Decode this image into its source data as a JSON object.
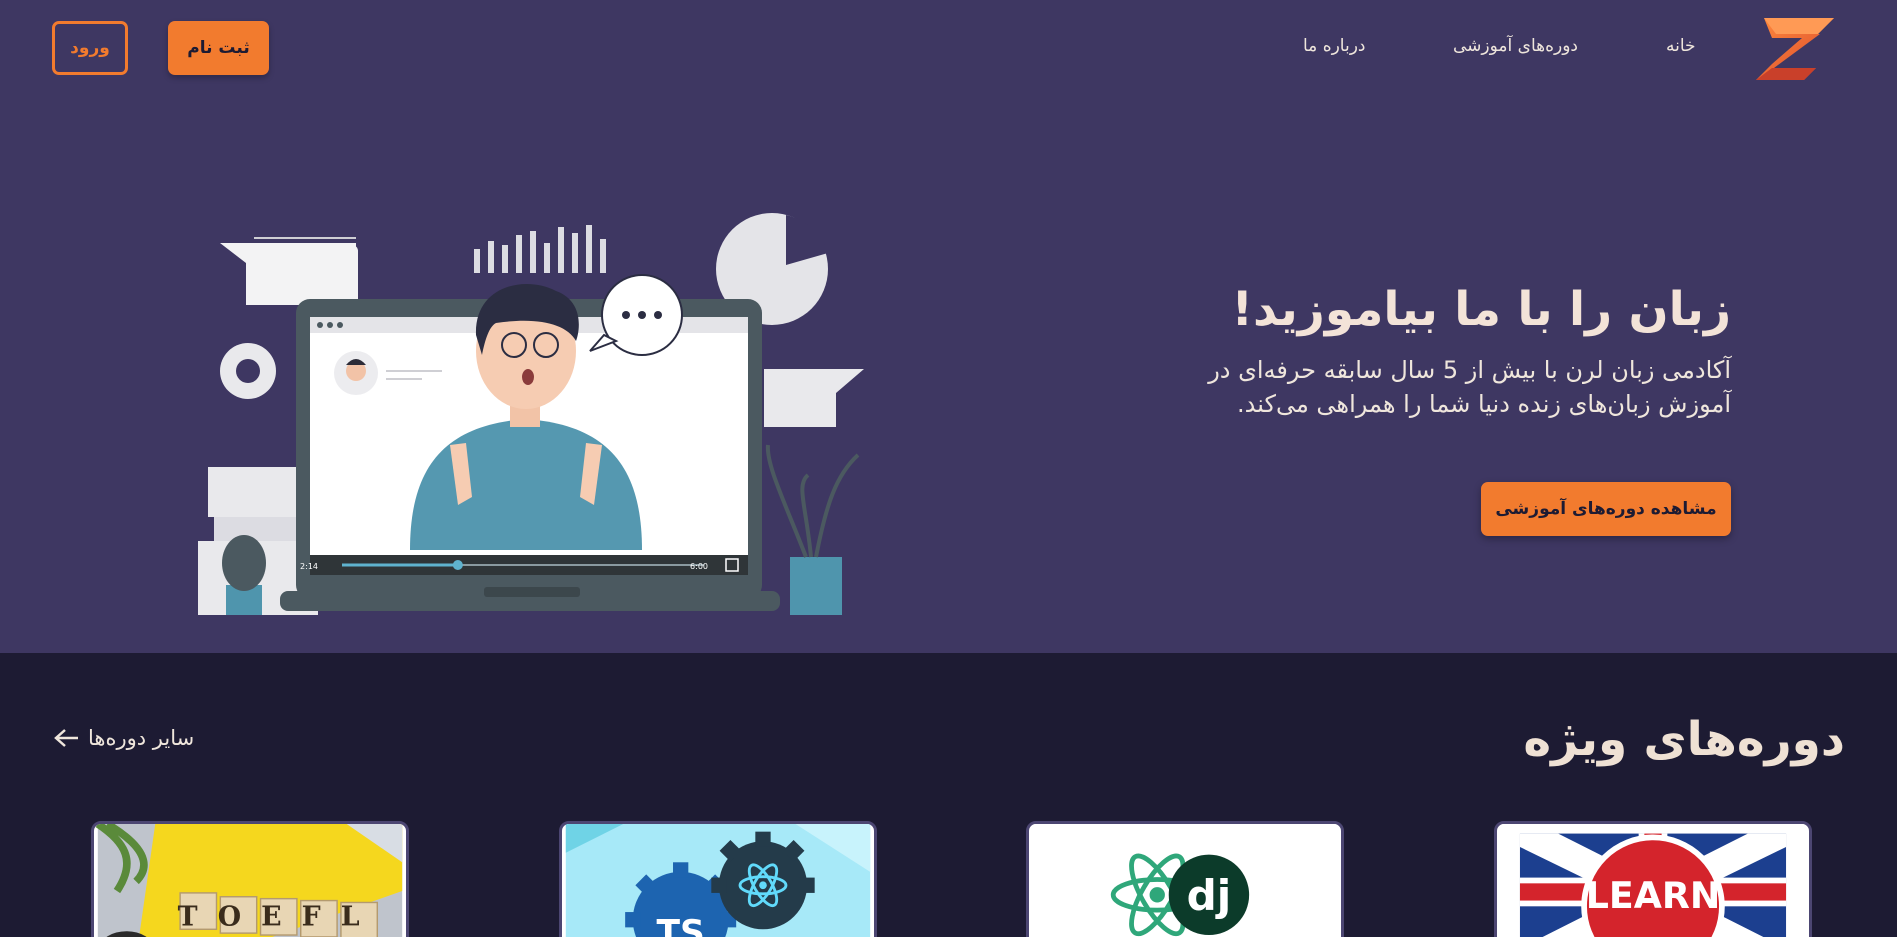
{
  "header": {
    "logo_icon": "z-logo-icon",
    "nav": {
      "home": "خانه",
      "courses": "دوره‌های آموزشی",
      "about": "درباره ما"
    },
    "signup_label": "ثبت نام",
    "login_label": "ورود"
  },
  "hero": {
    "title": "زبان را با ما بیاموزید!",
    "description": "آکادمی زبان لرن با بیش از 5 سال سابقه حرفه‌ای در آموزش زبان‌های زنده دنیا شما را همراهی می‌کند.",
    "cta_label": "مشاهده دوره‌های آموزشی",
    "video": {
      "current_time": "2:14",
      "duration": "6:00",
      "progress": 0.32
    }
  },
  "featured": {
    "title": "دوره‌های ویژه",
    "more_label": "سایر دوره‌ها",
    "cards": [
      {
        "image": "learn-english-flag-image",
        "badge": "LEARN"
      },
      {
        "image": "python-django-logos-image",
        "badge": "dj"
      },
      {
        "image": "typescript-react-gears-image",
        "badge": "TS"
      },
      {
        "image": "toefl-blocks-image",
        "badge": "TOEFL"
      }
    ]
  },
  "colors": {
    "hero_bg": "#3e3762",
    "page_bg": "#1d1b33",
    "accent": "#f27b2e",
    "text": "#f1e6dc"
  }
}
